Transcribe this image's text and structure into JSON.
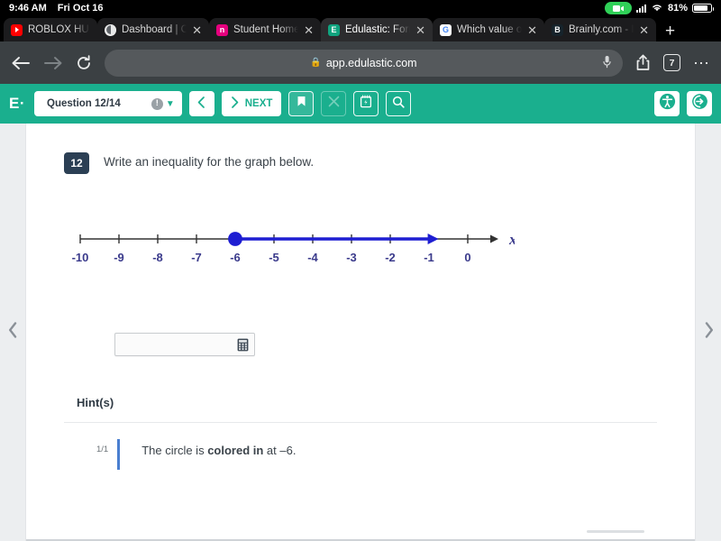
{
  "status_bar": {
    "time": "9:46 AM",
    "date": "Fri Oct 16",
    "recording_icon": "video-record-icon",
    "signal_icon": "cellular-signal-icon",
    "wifi_icon": "wifi-icon",
    "battery_percent": "81%",
    "battery_icon": "battery-icon"
  },
  "tabs": [
    {
      "title": "ROBLOX HU",
      "favicon": "youtube-icon",
      "favicon_letter": "",
      "active": false,
      "closable": false
    },
    {
      "title": "Dashboard | Co",
      "favicon": "globe-icon",
      "favicon_letter": "⊕",
      "active": false,
      "closable": true
    },
    {
      "title": "Student Home",
      "favicon": "nearpod-icon",
      "favicon_letter": "n",
      "active": false,
      "closable": true
    },
    {
      "title": "Edulastic: Form",
      "favicon": "edulastic-icon",
      "favicon_letter": "E",
      "active": true,
      "closable": true
    },
    {
      "title": "Which value of",
      "favicon": "google-icon",
      "favicon_letter": "G",
      "active": false,
      "closable": true
    },
    {
      "title": "Brainly.com - F",
      "favicon": "brainly-icon",
      "favicon_letter": "B",
      "active": false,
      "closable": true
    }
  ],
  "new_tab_label": "+",
  "browser": {
    "back_icon": "back-arrow-icon",
    "forward_icon": "forward-arrow-icon",
    "reload_icon": "reload-icon",
    "lock_icon": "lock-icon",
    "url": "app.edulastic.com",
    "mic_icon": "microphone-icon",
    "share_icon": "share-icon",
    "tab_count": "7",
    "more_icon": "more-options-icon"
  },
  "appbar": {
    "brand": "E·",
    "question_selector": "Question 12/14",
    "info_icon": "exclamation-icon",
    "chevron_icon": "chevron-down-icon",
    "prev_label": "",
    "prev_icon": "chevron-left-icon",
    "next_label": "NEXT",
    "next_icon": "chevron-right-icon",
    "bookmark_icon": "bookmark-icon",
    "close_icon": "close-x-icon",
    "scratchpad_icon": "scratchpad-icon",
    "zoom_icon": "magnifier-icon",
    "accessibility_icon": "accessibility-icon",
    "logout_icon": "logout-icon"
  },
  "nav": {
    "prev_icon": "chevron-left-icon",
    "next_icon": "chevron-right-icon"
  },
  "question": {
    "number": "12",
    "prompt": "Write an inequality for the graph below."
  },
  "answer": {
    "value": "",
    "placeholder": "",
    "keypad_icon": "calculator-keypad-icon"
  },
  "hints": {
    "title": "Hint(s)",
    "items": [
      {
        "index": "1/1",
        "text_before": "The circle is ",
        "text_bold": "colored in",
        "text_after": " at –6."
      }
    ]
  },
  "chart_data": {
    "type": "line",
    "title": "",
    "xlabel": "x",
    "ylabel": "",
    "xlim": [
      -10,
      0
    ],
    "ticks": [
      -10,
      -9,
      -8,
      -7,
      -6,
      -5,
      -4,
      -3,
      -2,
      -1,
      0
    ],
    "tick_labels": [
      "-10",
      "-9",
      "-8",
      "-7",
      "-6",
      "-5",
      "-4",
      "-3",
      "-2",
      "-1",
      "0"
    ],
    "grid": false,
    "legend": null,
    "axis_color": "#333333",
    "tick_label_color": "#3b3b8c",
    "series": [
      {
        "name": "solution-ray",
        "color": "#1e1ed2",
        "endpoint": -6,
        "endpoint_style": "closed-circle",
        "direction": "right",
        "arrow": true,
        "ray_end_visual": -0.8,
        "inequality": "x ≥ -6"
      }
    ]
  }
}
